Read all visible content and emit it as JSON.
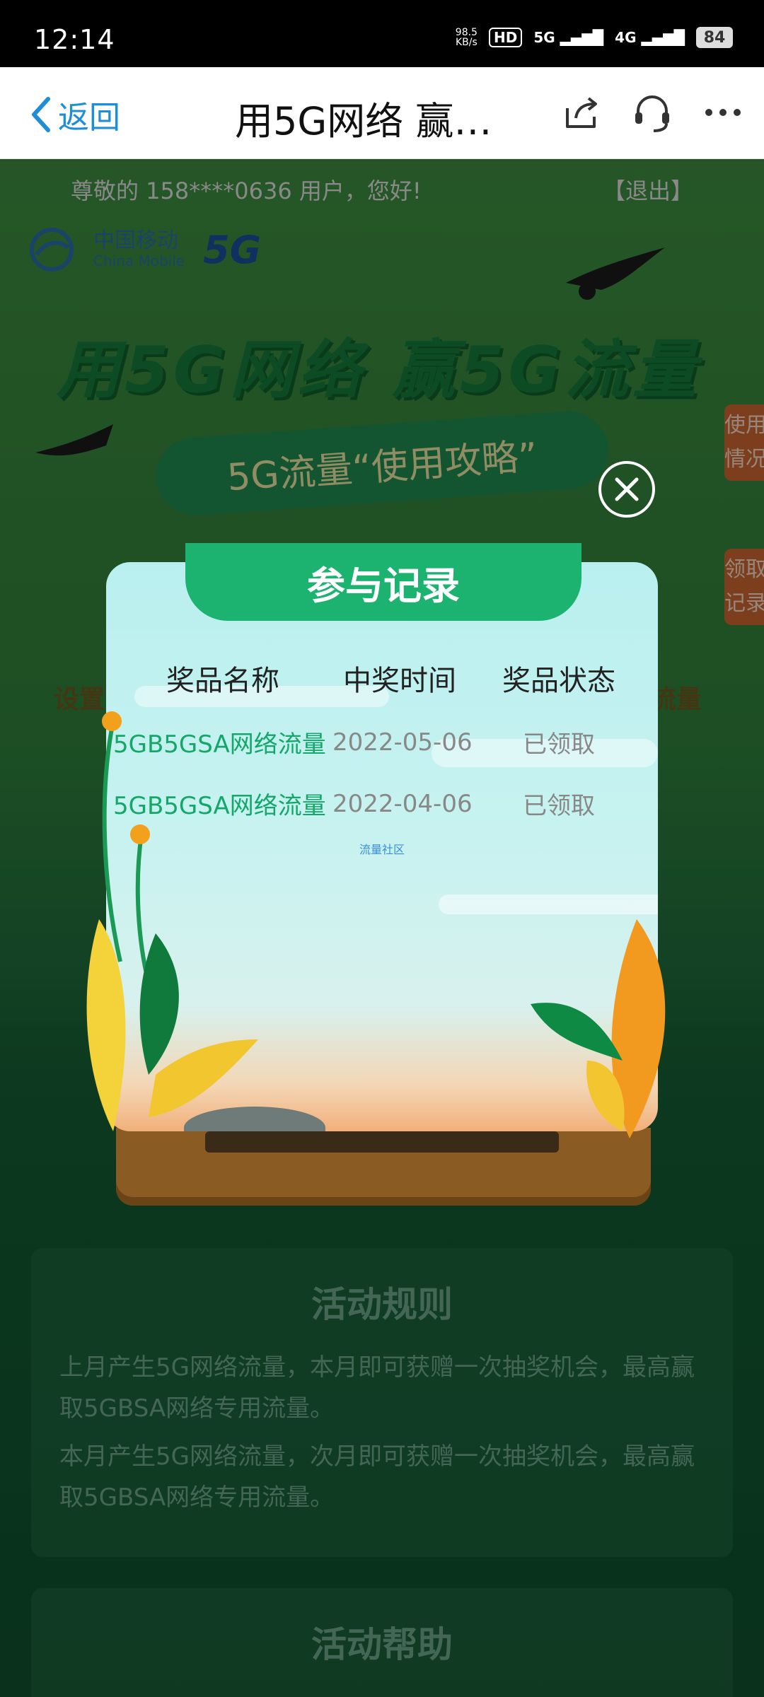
{
  "status_bar": {
    "time": "12:14",
    "net_speed": "98.5",
    "net_unit": "KB/s",
    "hd_label": "HD",
    "sim1_network": "5G",
    "sim2_network": "4G",
    "battery": "84"
  },
  "nav": {
    "back_label": "返回",
    "title": "用5G网络  赢…"
  },
  "page": {
    "greeting": "尊敬的 158****0636 用户，您好!",
    "logout": "【退出】",
    "brand_cn": "中国移动",
    "brand_en": "China Mobile",
    "brand_5g": "5G",
    "hero_title": "用5G网络  赢5G流量",
    "banner": "5G流量“使用攻略”",
    "side_tab_usage": "使用情况",
    "side_tab_records": "领取记录",
    "behind_left": "设置",
    "behind_right": "流量",
    "rules": {
      "title": "活动规则",
      "p1": "上月产生5G网络流量，本月即可获赠一次抽奖机会，最高赢取5GBSA网络专用流量。",
      "p2": "本月产生5G网络流量，次月即可获赠一次抽奖机会，最高赢取5GBSA网络专用流量。"
    },
    "help_title": "活动帮助"
  },
  "modal": {
    "title": "参与记录",
    "columns": [
      "奖品名称",
      "中奖时间",
      "奖品状态"
    ],
    "rows": [
      {
        "prize": "5GB5GSA网络流量",
        "date": "2022-05-06",
        "status": "已领取"
      },
      {
        "prize": "5GB5GSA网络流量",
        "date": "2022-04-06",
        "status": "已领取"
      }
    ],
    "footer_link": "流量社区"
  },
  "colors": {
    "accent_blue": "#1e8ed8",
    "modal_header_green": "#1bb36f",
    "prize_text_green": "#15a66a"
  }
}
